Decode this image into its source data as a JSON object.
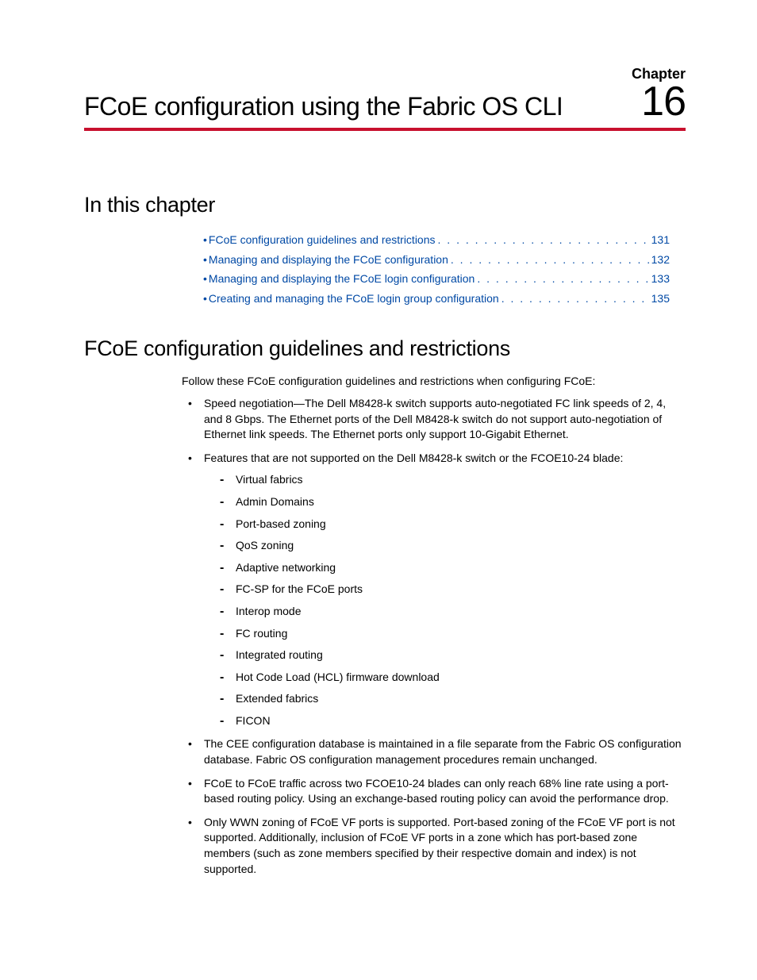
{
  "header": {
    "chapter_label": "Chapter",
    "chapter_title": "FCoE configuration using the Fabric OS CLI",
    "chapter_number": "16"
  },
  "section1": {
    "title": "In this chapter",
    "toc": [
      {
        "text": "FCoE configuration guidelines and restrictions",
        "page": "131"
      },
      {
        "text": "Managing and displaying the FCoE configuration",
        "page": "132"
      },
      {
        "text": "Managing and displaying the FCoE login configuration",
        "page": "133"
      },
      {
        "text": "Creating and managing the FCoE login group configuration",
        "page": "135"
      }
    ]
  },
  "section2": {
    "title": "FCoE configuration guidelines and restrictions",
    "intro": "Follow these FCoE configuration guidelines and restrictions when configuring FCoE:",
    "bullets": [
      "Speed negotiation—The Dell M8428-k switch supports auto-negotiated FC link speeds of 2, 4, and 8 Gbps. The Ethernet ports of the Dell M8428-k switch do not support auto-negotiation of Ethernet link speeds. The Ethernet ports only support 10-Gigabit Ethernet.",
      "Features that are not supported on the Dell M8428-k switch or the FCOE10-24 blade:",
      "The CEE configuration database is maintained in a file separate from the Fabric OS configuration database. Fabric OS configuration management procedures remain unchanged.",
      "FCoE to FCoE traffic across two FCOE10-24 blades can only reach 68% line rate using a port-based routing policy. Using an exchange-based routing policy can avoid the performance drop.",
      "Only WWN zoning of FCoE VF ports is supported. Port-based zoning of the FCoE VF port is not supported. Additionally, inclusion of FCoE VF ports in a zone which has port-based zone members (such as zone members specified by their respective domain and index) is not supported."
    ],
    "sublist": [
      "Virtual fabrics",
      "Admin Domains",
      "Port-based zoning",
      "QoS zoning",
      "Adaptive networking",
      "FC-SP for the FCoE ports",
      "Interop mode",
      "FC routing",
      "Integrated routing",
      "Hot Code Load (HCL) firmware download",
      "Extended fabrics",
      "FICON"
    ]
  }
}
